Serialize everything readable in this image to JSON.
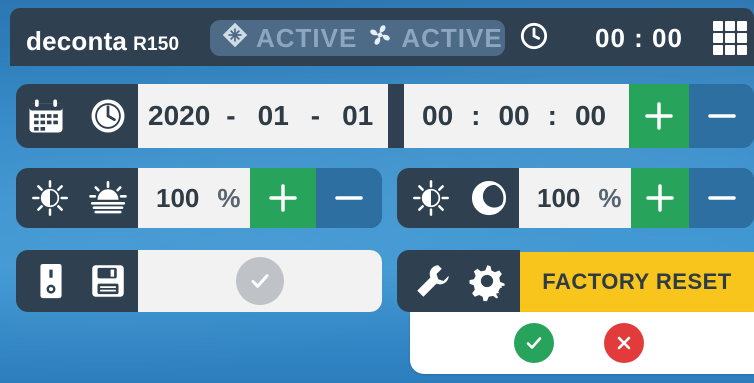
{
  "header": {
    "brand": "deconta",
    "model": "R150",
    "status_active_1": "ACTIVE",
    "status_active_2": "ACTIVE",
    "time": "00 : 00"
  },
  "datetime": {
    "year": "2020",
    "month": "01",
    "day": "01",
    "hours": "00",
    "minutes": "00",
    "seconds": "00",
    "sep_date": "-",
    "sep_time": ":"
  },
  "brightness_day": {
    "value": "100",
    "unit": "%"
  },
  "brightness_night": {
    "value": "100",
    "unit": "%"
  },
  "factory_reset": {
    "label": "FACTORY RESET"
  },
  "icons": {
    "calendar": "calendar-icon",
    "clock": "clock-icon",
    "brightness": "brightness-icon",
    "sunset": "sunset-icon",
    "moon": "moon-icon",
    "switch": "switch-icon",
    "save": "floppy-disk-icon",
    "wrench": "wrench-icon",
    "gear": "gear-icon",
    "check": "check-icon",
    "cancel": "cancel-icon",
    "menu": "grid-menu-icon",
    "fan": "fan-icon",
    "snow": "snowflake-icon"
  },
  "colors": {
    "bar": "#2f4150",
    "plus": "#27a35c",
    "minus": "#2d6fa1",
    "factory": "#f7c51c",
    "confirm": "#27a35c",
    "cancel": "#e23b3b"
  }
}
